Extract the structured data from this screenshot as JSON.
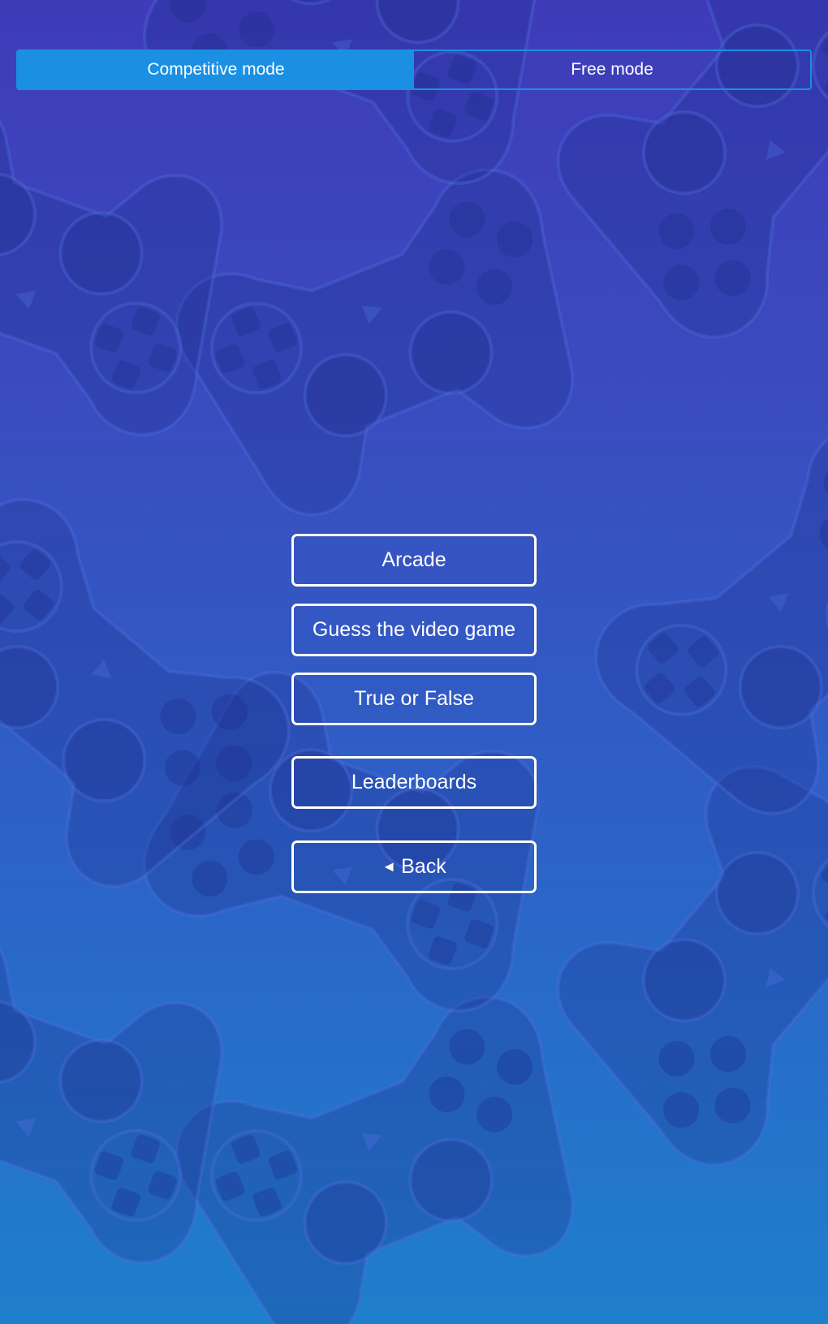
{
  "mode_toggle": {
    "tabs": [
      {
        "label": "Competitive mode",
        "active": true
      },
      {
        "label": "Free mode",
        "active": false
      }
    ]
  },
  "menu": {
    "arcade_label": "Arcade",
    "guess_label": "Guess the video game",
    "true_false_label": "True or False",
    "leaderboards_label": "Leaderboards",
    "back_label": "Back"
  },
  "icons": {
    "background_pattern": "gamepad-icon",
    "back": "left-triangle-icon"
  },
  "colors": {
    "accent": "#1a8fe3",
    "gradient_top": "#3f3bb9",
    "gradient_bottom": "#1f7fcc",
    "button_border": "#ffffff",
    "text": "#ffffff"
  }
}
